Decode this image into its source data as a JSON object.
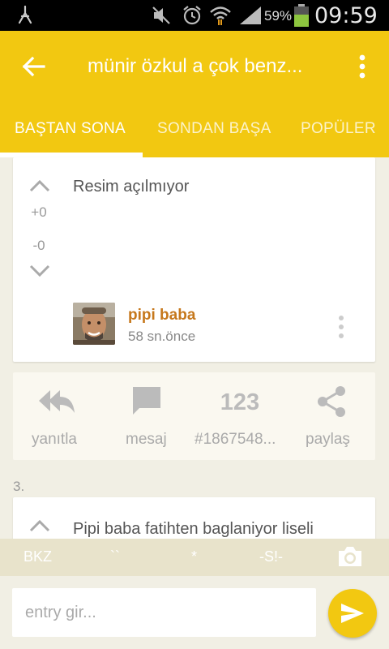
{
  "status_bar": {
    "battery_percent": "59%",
    "time": "09:59"
  },
  "app_bar": {
    "title": "münir özkul a çok benz...",
    "tabs": [
      {
        "label": "BAŞTAN SONA",
        "active": true
      },
      {
        "label": "SONDAN BAŞA",
        "active": false
      },
      {
        "label": "POPÜLER",
        "active": false
      }
    ]
  },
  "entries": [
    {
      "text": "Resim açılmıyor",
      "upvotes": "+0",
      "downvotes": "-0",
      "author": "pipi baba",
      "time_ago": "58 sn.önce"
    },
    {
      "index": "3.",
      "text": "Pipi baba fatihten baglaniyor liseli"
    }
  ],
  "actions": {
    "reply": {
      "label": "yanıtla",
      "icon": "reply-all-icon"
    },
    "message": {
      "label": "mesaj",
      "icon": "message-icon"
    },
    "number": {
      "label": "#1867548...",
      "icon": "numbers-123-icon"
    },
    "share": {
      "label": "paylaş",
      "icon": "share-icon"
    }
  },
  "shortcuts": {
    "bkz": "BKZ",
    "hidden": "``",
    "star": "*",
    "spoiler": "-S!-",
    "camera_icon": "camera-icon"
  },
  "input": {
    "placeholder": "entry gir..."
  },
  "colors": {
    "accent": "#f2c811",
    "author": "#c6781c",
    "background": "#f1efe4"
  }
}
